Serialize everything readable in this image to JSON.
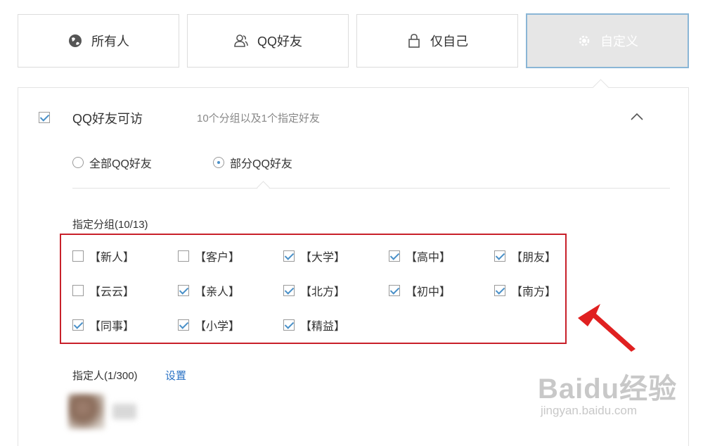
{
  "tabs": [
    {
      "label": "所有人",
      "icon": "globe-icon",
      "active": false
    },
    {
      "label": "QQ好友",
      "icon": "users-icon",
      "active": false
    },
    {
      "label": "仅自己",
      "icon": "lock-icon",
      "active": false
    },
    {
      "label": "自定义",
      "icon": "gear-icon",
      "active": true
    }
  ],
  "qq_access": {
    "checked": true,
    "title": "QQ好友可访",
    "summary": "10个分组以及1个指定好友"
  },
  "scope": {
    "all_label": "全部QQ好友",
    "partial_label": "部分QQ好友",
    "selected": "partial"
  },
  "groups_section": {
    "label": "指定分组(10/13)",
    "groups": [
      {
        "label": "【新人】",
        "checked": false
      },
      {
        "label": "【客户】",
        "checked": false
      },
      {
        "label": "【大学】",
        "checked": true
      },
      {
        "label": "【高中】",
        "checked": true
      },
      {
        "label": "【朋友】",
        "checked": true
      },
      {
        "label": "【云云】",
        "checked": false
      },
      {
        "label": "【亲人】",
        "checked": true
      },
      {
        "label": "【北方】",
        "checked": true
      },
      {
        "label": "【初中】",
        "checked": true
      },
      {
        "label": "【南方】",
        "checked": true
      },
      {
        "label": "【同事】",
        "checked": true
      },
      {
        "label": "【小学】",
        "checked": true
      },
      {
        "label": "【精益】",
        "checked": true
      }
    ]
  },
  "people_section": {
    "label": "指定人(1/300)",
    "settings_link": "设置"
  },
  "watermark": {
    "main": "Baidu经验",
    "sub": "jingyan.baidu.com"
  },
  "colors": {
    "accent": "#4a90c8",
    "highlight_border": "#c8202a",
    "arrow": "#e02020",
    "link": "#2a72c4"
  }
}
